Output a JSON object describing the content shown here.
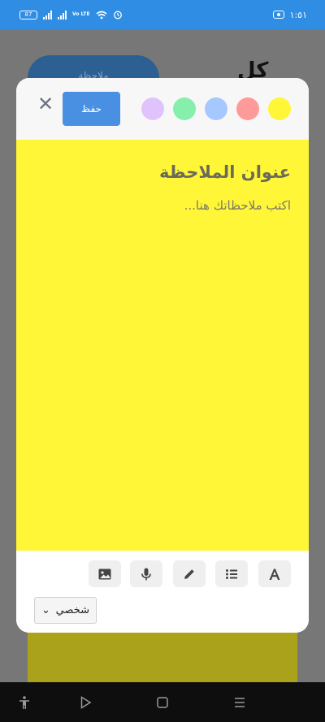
{
  "status_bar": {
    "battery_text": "87",
    "network_type": "Vo LTE",
    "time": "١:٥١"
  },
  "background_app": {
    "pill_label": "ملاحظة",
    "heading": "كل"
  },
  "modal": {
    "save_label": "حفظ",
    "close_label": "✕",
    "colors": [
      {
        "name": "purple",
        "hex": "#e0c3fc"
      },
      {
        "name": "green",
        "hex": "#86efac"
      },
      {
        "name": "blue",
        "hex": "#a5c8ff"
      },
      {
        "name": "red",
        "hex": "#ff9a9a"
      },
      {
        "name": "yellow",
        "hex": "#fff637"
      }
    ],
    "selected_color": "yellow",
    "title_placeholder": "عنوان الملاحظة",
    "body_placeholder": "اكتب ملاحظاتك هنا...",
    "toolbar": {
      "tools": [
        "image-icon",
        "microphone-icon",
        "pencil-icon",
        "list-icon",
        "text-format-icon"
      ],
      "category_value": "شخصي",
      "category_arrow": "⌄"
    }
  },
  "nav_bar": {
    "icons": [
      "accessibility-icon",
      "back-icon",
      "home-icon",
      "menu-icon"
    ]
  }
}
